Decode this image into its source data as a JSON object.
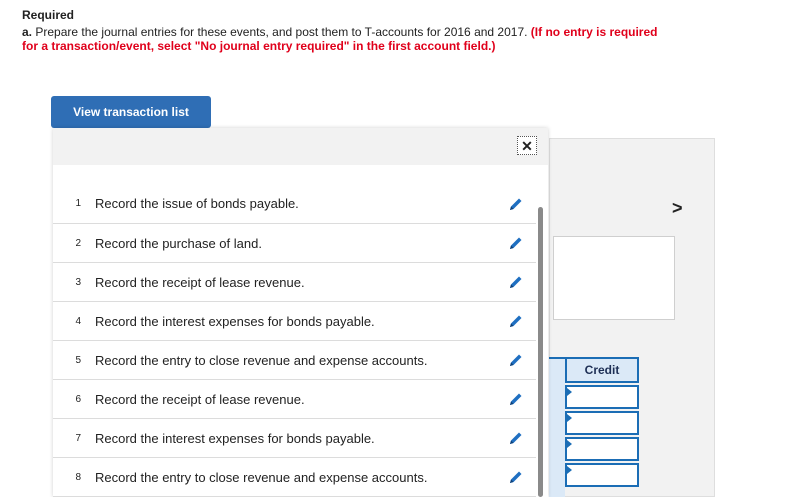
{
  "header": {
    "title": "Required",
    "item_label": "a.",
    "instruction": "Prepare the journal entries for these events, and post them to T-accounts for 2016 and 2017.",
    "note": "(If no entry is required for a transaction/event, select \"No journal entry required\" in the first account field.)"
  },
  "view_button": {
    "label": "View transaction list"
  },
  "background": {
    "chevron": ">",
    "credit_header": "Credit",
    "credit_rows": 4
  },
  "modal": {
    "close_glyph": "✕",
    "transactions": [
      {
        "num": "1",
        "text": "Record the issue of bonds payable."
      },
      {
        "num": "2",
        "text": "Record the purchase of land."
      },
      {
        "num": "3",
        "text": "Record the receipt of lease revenue."
      },
      {
        "num": "4",
        "text": "Record the interest expenses for bonds payable."
      },
      {
        "num": "5",
        "text": "Record the entry to close revenue and expense accounts."
      },
      {
        "num": "6",
        "text": "Record the receipt of lease revenue."
      },
      {
        "num": "7",
        "text": "Record the interest expenses for bonds payable."
      },
      {
        "num": "8",
        "text": "Record the entry to close revenue and expense accounts."
      }
    ]
  },
  "colors": {
    "button": "#2f6eb5",
    "accent": "#1b6db5",
    "note": "#e0001b",
    "pencil": "#1f6fc1"
  },
  "icons": {
    "edit": "pencil-icon",
    "close": "close-icon",
    "chevron": "chevron-right-icon"
  }
}
